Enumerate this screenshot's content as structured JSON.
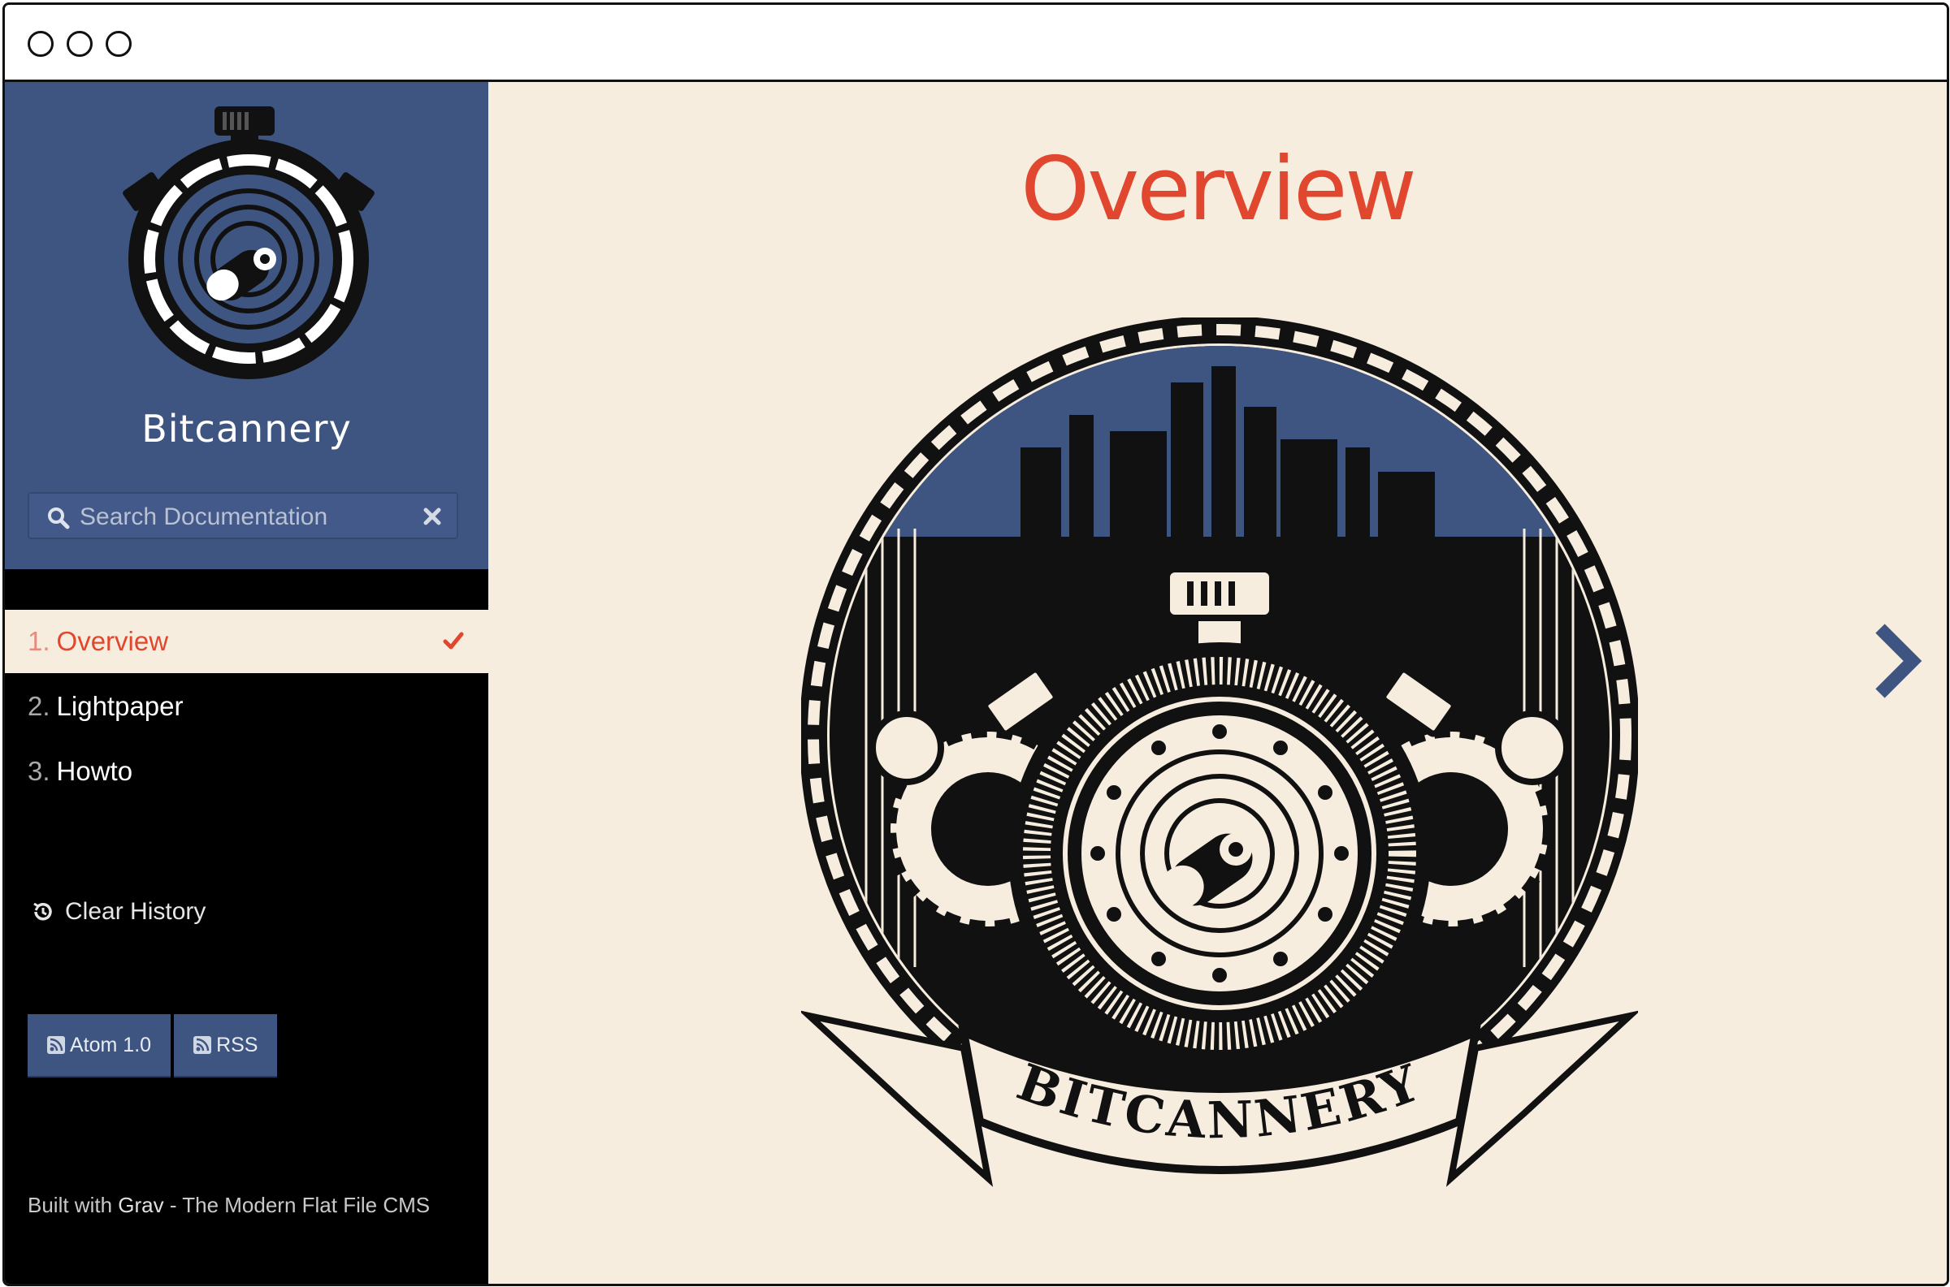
{
  "window": {
    "controls": [
      "close",
      "minimize",
      "maximize"
    ]
  },
  "sidebar": {
    "brand": "Bitcannery",
    "search": {
      "placeholder": "Search Documentation",
      "value": ""
    },
    "nav": [
      {
        "number": "1.",
        "label": "Overview",
        "active": true,
        "visited": true
      },
      {
        "number": "2.",
        "label": "Lightpaper",
        "active": false,
        "visited": false
      },
      {
        "number": "3.",
        "label": "Howto",
        "active": false,
        "visited": false
      }
    ],
    "clear_history": "Clear History",
    "feeds": [
      {
        "label": "Atom 1.0",
        "icon": "rss-icon"
      },
      {
        "label": "RSS",
        "icon": "rss-icon"
      }
    ],
    "footer": {
      "prefix": "Built with ",
      "link": "Grav",
      "suffix": " - The Modern Flat File CMS"
    }
  },
  "main": {
    "title": "Overview",
    "emblem_text": "BITCANNERY",
    "next_icon": "chevron-right-icon"
  },
  "colors": {
    "sidebar_header": "#3f5581",
    "sidebar_bg": "#000000",
    "content_bg": "#f6eddf",
    "accent": "#e0472e"
  }
}
